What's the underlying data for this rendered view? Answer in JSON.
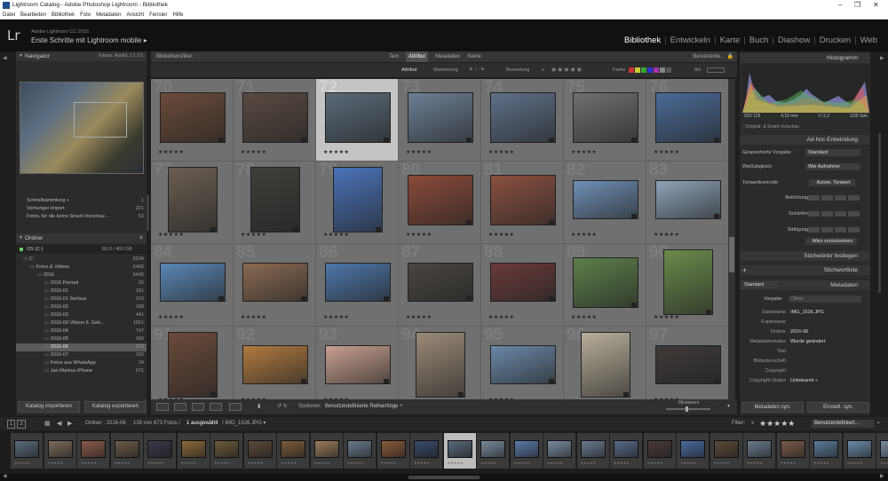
{
  "window": {
    "title": "Lightroom Catalog - Adobe Photoshop Lightroom - Bibliothek",
    "minimize": "–",
    "maximize": "❐",
    "close": "✕"
  },
  "menu": [
    "Datei",
    "Bearbeiten",
    "Bibliothek",
    "Foto",
    "Metadaten",
    "Ansicht",
    "Fenster",
    "Hilfe"
  ],
  "identity": {
    "logo": "Lr",
    "version": "Adobe Lightroom CC 2015",
    "catalog": "Erste Schritte mit Lightroom mobile  ▸"
  },
  "modules": [
    {
      "label": "Bibliothek",
      "active": true
    },
    {
      "label": "Entwickeln",
      "active": false
    },
    {
      "label": "Karte",
      "active": false
    },
    {
      "label": "Buch",
      "active": false
    },
    {
      "label": "Diashow",
      "active": false
    },
    {
      "label": "Drucken",
      "active": false
    },
    {
      "label": "Web",
      "active": false
    }
  ],
  "navigator": {
    "title": "Navigator",
    "zoom": [
      "Einpas.",
      "Ausfül.",
      "1:1",
      "3:1"
    ]
  },
  "catalog_items": [
    {
      "label": "Schnellsammlung +",
      "count": "1"
    },
    {
      "label": "Vorheriger Import",
      "count": "221"
    },
    {
      "label": "Fotos, für die keine Smart-Vorschau ...",
      "count": "52"
    }
  ],
  "folders": {
    "title": "Ordner",
    "drive": {
      "label": "OS (C:)",
      "space": "89,0 / 400 GB"
    },
    "items": [
      {
        "label": "C:",
        "count": "6534",
        "indent": 0,
        "selected": false
      },
      {
        "label": "Fotos & Videos",
        "count": "6466",
        "indent": 1,
        "selected": false
      },
      {
        "label": "2016",
        "count": "6405",
        "indent": 2,
        "selected": false
      },
      {
        "label": "2016 Portrait",
        "count": "20",
        "indent": 3,
        "selected": false
      },
      {
        "label": "2016-01",
        "count": "161",
        "indent": 3,
        "selected": false
      },
      {
        "label": "2016-01 Serfaus",
        "count": "213",
        "indent": 3,
        "selected": false
      },
      {
        "label": "2016-02",
        "count": "188",
        "indent": 3,
        "selected": false
      },
      {
        "label": "2016-03",
        "count": "441",
        "indent": 3,
        "selected": false
      },
      {
        "label": "2016-03 Viktors 6. Geb...",
        "count": "1051",
        "indent": 3,
        "selected": false
      },
      {
        "label": "2016-04",
        "count": "747",
        "indent": 3,
        "selected": false
      },
      {
        "label": "2016-05",
        "count": "390",
        "indent": 3,
        "selected": false
      },
      {
        "label": "2016-06",
        "count": "673",
        "indent": 3,
        "selected": true
      },
      {
        "label": "2016-07",
        "count": "325",
        "indent": 3,
        "selected": false
      },
      {
        "label": "Fotos aus WhatsApp",
        "count": "24",
        "indent": 3,
        "selected": false
      },
      {
        "label": "Jan-Markus iPhone",
        "count": "971",
        "indent": 3,
        "selected": false
      }
    ]
  },
  "left_buttons": {
    "import": "Katalog importieren",
    "export": "Katalog exportieren"
  },
  "filter": {
    "title": "Bibliotheksfilter:",
    "tabs": [
      "Text",
      "Attribut",
      "Metadaten",
      "Keine"
    ],
    "active_tab": "Attribut",
    "preset": "Benutzerde...",
    "attr_label": "Attribut",
    "flag_label": "Markierung",
    "rating_label": "Bewertung",
    "rating_op": "≥",
    "color_label": "Farbe",
    "kind_label": "Art"
  },
  "grid": {
    "cells": [
      {
        "num": "70",
        "stars": "★★★★★",
        "color": "#6b4b3a",
        "w": 74,
        "h": 57,
        "sel": false
      },
      {
        "num": "71",
        "stars": "★★★★★",
        "color": "#5a4a42",
        "w": 74,
        "h": 57,
        "sel": false
      },
      {
        "num": "72",
        "stars": "★★★★★",
        "color": "#5a6a78",
        "w": 74,
        "h": 57,
        "sel": true
      },
      {
        "num": "73",
        "stars": "★★★★★",
        "color": "#6d7f95",
        "w": 74,
        "h": 57,
        "sel": false
      },
      {
        "num": "74",
        "stars": "★★★★★",
        "color": "#5f7089",
        "w": 74,
        "h": 57,
        "sel": false
      },
      {
        "num": "75",
        "stars": "★★★★★",
        "color": "#6e7072",
        "w": 74,
        "h": 57,
        "sel": false
      },
      {
        "num": "76",
        "stars": "★★★★★",
        "color": "#4a6a96",
        "w": 74,
        "h": 57,
        "sel": false
      },
      {
        "num": "77",
        "stars": "★★★★★",
        "color": "#6a5e52",
        "w": 56,
        "h": 74,
        "sel": false
      },
      {
        "num": "78",
        "stars": "★★★★★",
        "color": "#3e3f3a",
        "w": 56,
        "h": 74,
        "sel": false
      },
      {
        "num": "79",
        "stars": "★★★★★",
        "color": "#4a72b8",
        "w": 56,
        "h": 74,
        "sel": false
      },
      {
        "num": "80",
        "stars": "★★★★★",
        "color": "#8a4a3a",
        "w": 74,
        "h": 57,
        "sel": false
      },
      {
        "num": "81",
        "stars": "★★★★★",
        "color": "#8a5040",
        "w": 74,
        "h": 57,
        "sel": false
      },
      {
        "num": "82",
        "stars": "★★★★★",
        "color": "#6f8fb5",
        "w": 74,
        "h": 44,
        "sel": false
      },
      {
        "num": "83",
        "stars": "★★★★★",
        "color": "#8ea3b8",
        "w": 74,
        "h": 44,
        "sel": false
      },
      {
        "num": "84",
        "stars": "★★★★★",
        "color": "#5a87b6",
        "w": 74,
        "h": 44,
        "sel": false
      },
      {
        "num": "85",
        "stars": "★★★★★",
        "color": "#8a6a52",
        "w": 74,
        "h": 44,
        "sel": false
      },
      {
        "num": "86",
        "stars": "★★★★★",
        "color": "#4d76a9",
        "w": 74,
        "h": 44,
        "sel": false
      },
      {
        "num": "87",
        "stars": "★★★★★",
        "color": "#4a4640",
        "w": 74,
        "h": 44,
        "sel": false
      },
      {
        "num": "88",
        "stars": "★★★★★",
        "color": "#6a3a3a",
        "w": 74,
        "h": 44,
        "sel": false
      },
      {
        "num": "89",
        "stars": "★★★★★",
        "color": "#5d7f4a",
        "w": 74,
        "h": 57,
        "sel": false
      },
      {
        "num": "90",
        "stars": "★★★★★",
        "color": "#6a8a4a",
        "w": 56,
        "h": 74,
        "sel": false
      },
      {
        "num": "91",
        "stars": "★★★★★",
        "color": "#6a4a3a",
        "w": 56,
        "h": 74,
        "sel": false
      },
      {
        "num": "92",
        "stars": "★★★★★",
        "color": "#b07a40",
        "w": 74,
        "h": 44,
        "sel": false
      },
      {
        "num": "93",
        "stars": "★★★★★",
        "color": "#c8a090",
        "w": 74,
        "h": 44,
        "sel": false
      },
      {
        "num": "94",
        "stars": "",
        "color": "#9a8a78",
        "w": 56,
        "h": 74,
        "sel": false
      },
      {
        "num": "95",
        "stars": "★★★★★",
        "color": "#6a88a8",
        "w": 74,
        "h": 44,
        "sel": false
      },
      {
        "num": "96",
        "stars": "",
        "color": "#b8ae9a",
        "w": 56,
        "h": 74,
        "sel": false
      },
      {
        "num": "97",
        "stars": "★★★★★",
        "color": "#3e3a38",
        "w": 74,
        "h": 44,
        "sel": false
      },
      {
        "num": "98",
        "stars": "★★★★★",
        "color": "#5a5248",
        "w": 74,
        "h": 44,
        "sel": false
      }
    ]
  },
  "toolbar": {
    "sort_label": "Sortieren:",
    "sort_value": "Benutzerdefinierte Reihenfolge ÷",
    "thumb_label": "Miniaturen"
  },
  "histogram": {
    "title": "Histogramm",
    "iso": "ISO 125",
    "focal": "4,15 mm",
    "aperture": "f / 2,2",
    "shutter": "1/35 Sek.",
    "preview": "Original- & Smart-Vorschau"
  },
  "quick_develop": {
    "title": "Ad-hoc-Entwicklung",
    "preset_label": "Gespeicherte Vorgabe",
    "preset_value": "Standard",
    "wb_label": "Weißabgleich",
    "wb_value": "Wie Aufnahme",
    "tone_label": "Tonwertkontrolle",
    "tone_btn": "Autom. Tonwert",
    "rows": [
      "Belichtung",
      "Schärfen",
      "Sättigung"
    ],
    "reset": "Alles zurücksetzen"
  },
  "keywording": {
    "title": "Stichwörter festlegen"
  },
  "keyword_list": {
    "title": "Stichwortliste",
    "plus": "+"
  },
  "metadata": {
    "title": "Metadaten",
    "preset_select": "Standard",
    "vorgabe_label": "Vorgabe",
    "vorgabe_value": "Ohne",
    "fields": [
      {
        "label": "Dateiname",
        "value": "IMG_1526.JPG"
      },
      {
        "label": "Kopiename",
        "value": ""
      },
      {
        "label": "Ordner",
        "value": "2016-06"
      },
      {
        "label": "Metadatenstatus",
        "value": "Wurde geändert"
      },
      {
        "label": "Titel",
        "value": ""
      },
      {
        "label": "Bildunterschrift",
        "value": ""
      },
      {
        "label": "Copyright",
        "value": ""
      },
      {
        "label": "Copyright-Status",
        "value": "Unbekannt ÷"
      }
    ]
  },
  "right_buttons": {
    "sync_meta": "Metadaten syn.",
    "sync_settings": "Einstell. syn."
  },
  "filmstrip_bar": {
    "pages": [
      "1",
      "2"
    ],
    "path": "Ordner : 2016-06",
    "info": "139 von 673 Fotos /",
    "selected": "1 ausgewählt",
    "file": "/ IMG_1526.JPG ▾",
    "filter_label": "Filter:",
    "filter_op": "≥",
    "filter_stars": "★★★★★",
    "filter_preset": "Benutzerdefiniert..."
  },
  "filmstrip": {
    "colors": [
      "#5a6a7a",
      "#7a6a5a",
      "#8a5a4a",
      "#6a5a4a",
      "#3a3a4a",
      "#8a6a3a",
      "#6a5a3a",
      "#5a4a3a",
      "#7a5a3a",
      "#9a7a5a",
      "#6a7a8a",
      "#8a5a3a",
      "#3a4a6a",
      "#5a6a7a",
      "#7a8a9a",
      "#5a7aa8",
      "#7a8aa0",
      "#6a7a90",
      "#5a6a8a",
      "#4a3a3a",
      "#4a6aa0",
      "#5a4a3a",
      "#6a7a8a",
      "#7a5a4a",
      "#5a7a9a",
      "#6a8aa8",
      "#7a8ca0"
    ],
    "selected_index": 13
  }
}
